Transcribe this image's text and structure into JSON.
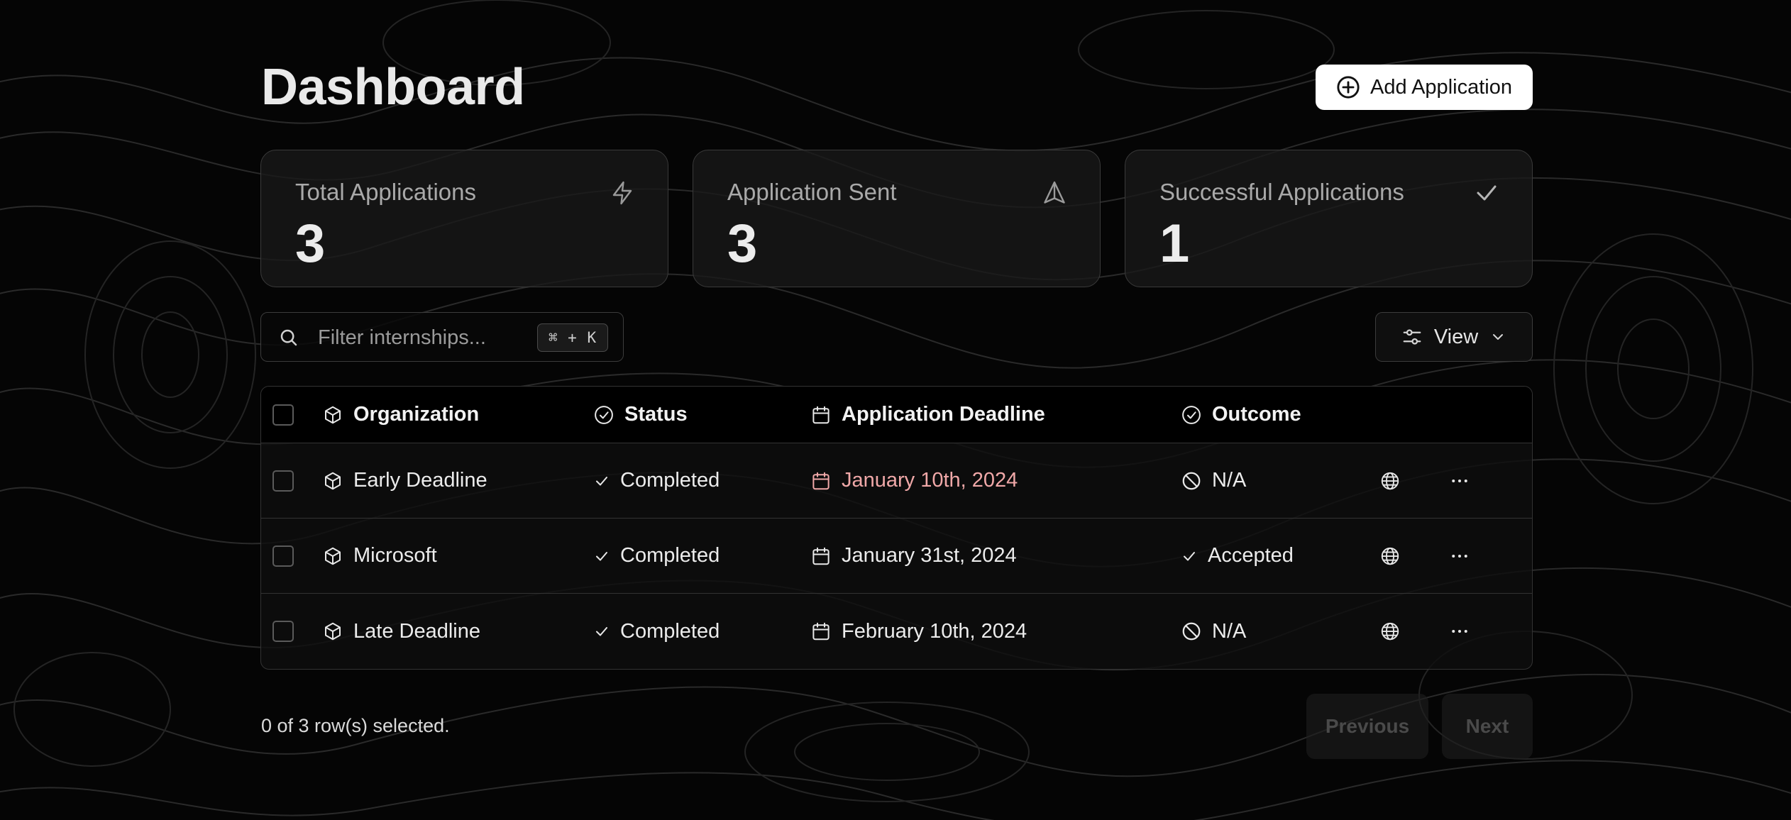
{
  "header": {
    "title": "Dashboard",
    "add_button_label": "Add Application"
  },
  "stats": [
    {
      "label": "Total Applications",
      "value": "3",
      "icon": "lightning-icon"
    },
    {
      "label": "Application Sent",
      "value": "3",
      "icon": "send-icon"
    },
    {
      "label": "Successful Applications",
      "value": "1",
      "icon": "check-icon"
    }
  ],
  "filter": {
    "placeholder": "Filter internships...",
    "shortcut": "⌘ + K"
  },
  "view_button_label": "View",
  "table": {
    "columns": [
      "Organization",
      "Status",
      "Application Deadline",
      "Outcome"
    ],
    "rows": [
      {
        "organization": "Early Deadline",
        "status": "Completed",
        "deadline": "January 10th, 2024",
        "outcome": "N/A",
        "deadline_overdue": true
      },
      {
        "organization": "Microsoft",
        "status": "Completed",
        "deadline": "January 31st, 2024",
        "outcome": "Accepted",
        "deadline_overdue": false
      },
      {
        "organization": "Late Deadline",
        "status": "Completed",
        "deadline": "February 10th, 2024",
        "outcome": "N/A",
        "deadline_overdue": false
      }
    ]
  },
  "footer": {
    "selection_text": "0 of 3 row(s) selected.",
    "previous_label": "Previous",
    "next_label": "Next"
  },
  "colors": {
    "background": "#050505",
    "accent_button": "#ffffff",
    "overdue_date": "#f0a8a8",
    "border": "#333333"
  }
}
